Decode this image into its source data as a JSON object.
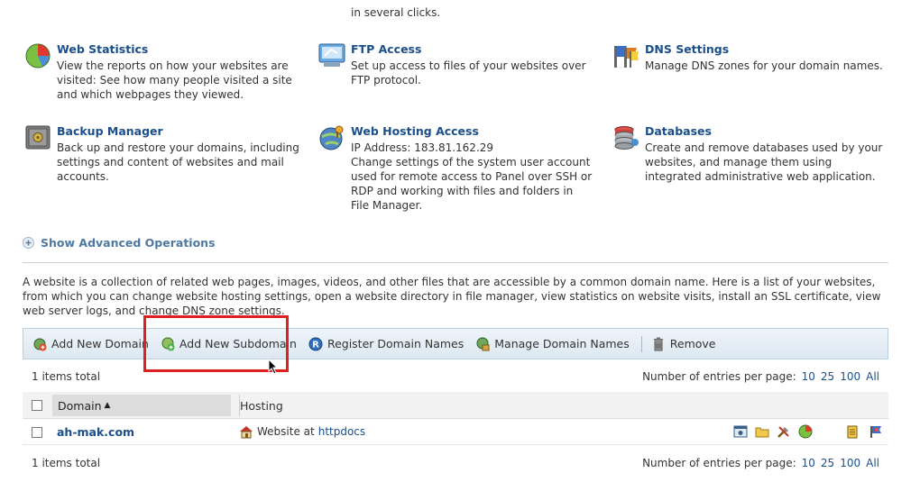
{
  "top_fragment": "in several clicks.",
  "features": [
    {
      "id": "web-statistics",
      "title": "Web Statistics",
      "desc": "View the reports on how your websites are visited: See how many people visited a site and which webpages they viewed.",
      "icon": "pie-chart-icon"
    },
    {
      "id": "ftp-access",
      "title": "FTP Access",
      "desc": "Set up access to files of your websites over FTP protocol.",
      "icon": "ftp-monitor-icon"
    },
    {
      "id": "dns-settings",
      "title": "DNS Settings",
      "desc": "Manage DNS zones for your domain names.",
      "icon": "dns-flags-icon"
    },
    {
      "id": "backup-manager",
      "title": "Backup Manager",
      "desc": "Back up and restore your domains, including settings and content of websites and mail accounts.",
      "icon": "safe-icon"
    },
    {
      "id": "web-hosting-access",
      "title": "Web Hosting Access",
      "desc_ip": "IP Address: 183.81.162.29",
      "desc": "Change settings of the system user account used for remote access to Panel over SSH or RDP and working with files and folders in File Manager.",
      "icon": "globe-key-icon"
    },
    {
      "id": "databases",
      "title": "Databases",
      "desc": "Create and remove databases used by your websites, and manage them using integrated administrative web application.",
      "icon": "database-icon"
    }
  ],
  "advanced": {
    "label": "Show Advanced Operations",
    "icon": "expand-plus-icon"
  },
  "intro": "A website is a collection of related web pages, images, videos, and other files that are accessible by a common domain name. Here is a list of your websites, from which you can change website hosting settings, open a website directory in file manager, view statistics on website visits, install an SSL certificate, view web server logs, and change DNS zone settings.",
  "toolbar": {
    "add_domain": "Add New Domain",
    "add_subdomain": "Add New Subdomain",
    "register_domain": "Register Domain Names",
    "manage_domain": "Manage Domain Names",
    "remove": "Remove"
  },
  "pager": {
    "items_total": "1 items total",
    "per_page_label": "Number of entries per page:",
    "options": [
      "10",
      "25",
      "100",
      "All"
    ]
  },
  "table": {
    "col_domain": "Domain",
    "col_hosting": "Hosting",
    "sort_indicator": "▲",
    "rows": [
      {
        "domain": "ah-mak.com",
        "hosting_prefix": "Website at",
        "hosting_link": "httpdocs"
      }
    ]
  },
  "colors": {
    "link": "#1a4f8b",
    "highlight": "#e02020",
    "toolbar_bg": "#e4edf6"
  }
}
